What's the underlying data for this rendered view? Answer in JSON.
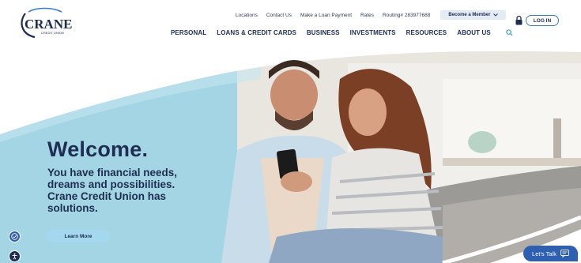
{
  "brand": {
    "logo_text": "CRANE",
    "logo_subtext": "CREDIT UNION"
  },
  "utility_nav": {
    "items": [
      "Locations",
      "Contact Us",
      "Make a Loan Payment",
      "Rates",
      "Routing# 283977688"
    ],
    "member_button": "Become a Member"
  },
  "main_nav": {
    "items": [
      "PERSONAL",
      "LOANS & CREDIT CARDS",
      "BUSINESS",
      "INVESTMENTS",
      "RESOURCES",
      "ABOUT US"
    ]
  },
  "login": {
    "label": "LOG IN"
  },
  "hero": {
    "heading": "Welcome.",
    "tagline": "You have financial needs, dreams and possibilities. Crane Credit Union has solutions.",
    "cta": "Learn More"
  },
  "chat": {
    "label": "Let's Talk"
  },
  "colors": {
    "navy": "#1e2d52",
    "accent_blue": "#2f5fb0",
    "light_blue": "#a3d8ef",
    "hero_teal": "#9dd4e4"
  }
}
